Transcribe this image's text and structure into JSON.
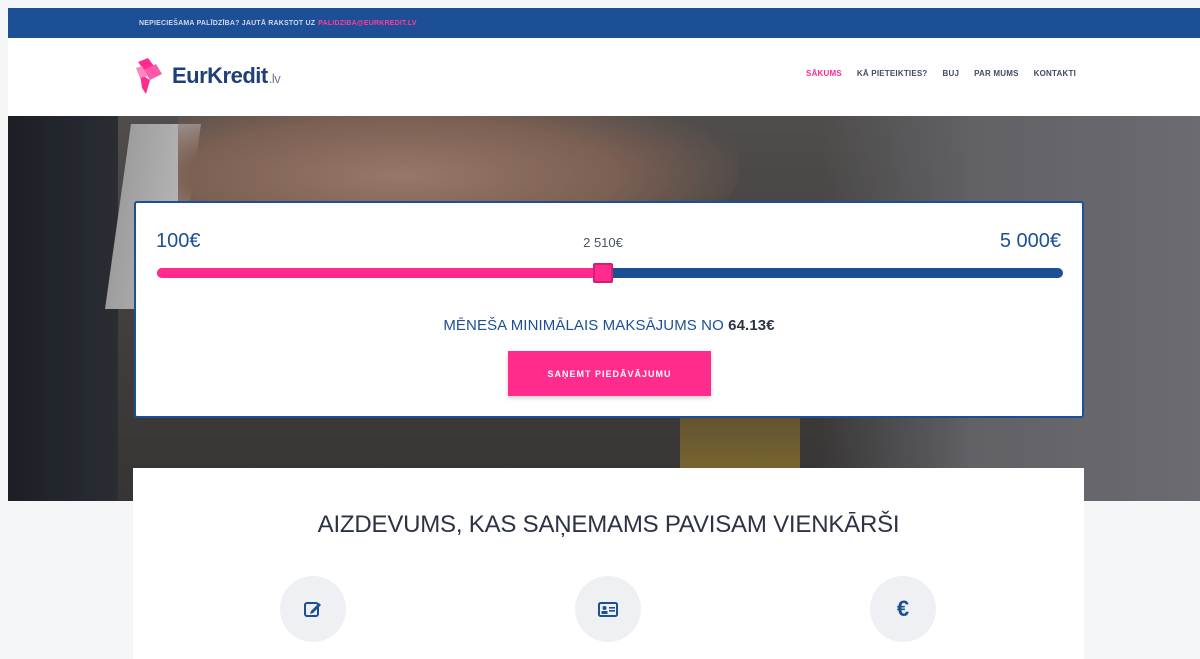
{
  "topbar": {
    "text": "NEPIECIEŠAMA PALĪDZĪBA? JAUTĀ RAKSTOT UZ",
    "email": "PALIDZIBA@EURKREDIT.LV"
  },
  "header": {
    "logo": {
      "name": "EurKredit",
      "tld": ".lv"
    },
    "nav": [
      {
        "label": "SĀKUMS",
        "active": true
      },
      {
        "label": "KĀ PIETEIKTIES?",
        "active": false
      },
      {
        "label": "BUJ",
        "active": false
      },
      {
        "label": "PAR MUMS",
        "active": false
      },
      {
        "label": "KONTAKTI",
        "active": false
      }
    ]
  },
  "calculator": {
    "min_label": "100€",
    "max_label": "5 000€",
    "current_label": "2 510€",
    "min_value": 100,
    "max_value": 5000,
    "current_value": 2510,
    "payment_text": "MĒNEŠA MINIMĀLAIS MAKSĀJUMS NO",
    "payment_value": "64.13€",
    "cta_label": "SAŅEMT PIEDĀVĀJUMU"
  },
  "content": {
    "heading": "AIZDEVUMS, KAS SAŅEMAMS PAVISAM VIENKĀRŠI",
    "features": [
      {
        "icon": "edit-icon"
      },
      {
        "icon": "id-card-icon"
      },
      {
        "icon": "euro-icon",
        "glyph": "€"
      }
    ]
  },
  "colors": {
    "primary": "#1c4f96",
    "accent": "#ff2c8d",
    "text_dark": "#2c3344"
  }
}
